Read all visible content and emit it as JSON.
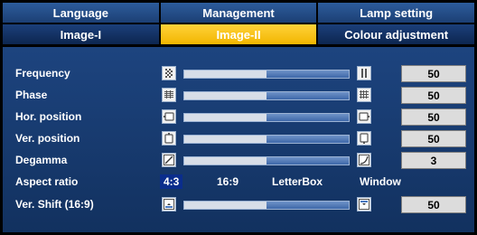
{
  "tabs_row1": [
    "Language",
    "Management",
    "Lamp setting"
  ],
  "tabs_row2": [
    "Image-I",
    "Image-II",
    "Colour adjustment"
  ],
  "active_tab": "Image-II",
  "rows": {
    "frequency": {
      "label": "Frequency",
      "value": "50",
      "level": 0.5
    },
    "phase": {
      "label": "Phase",
      "value": "50",
      "level": 0.5
    },
    "hor_position": {
      "label": "Hor. position",
      "value": "50",
      "level": 0.5
    },
    "ver_position": {
      "label": "Ver. position",
      "value": "50",
      "level": 0.5
    },
    "degamma": {
      "label": "Degamma",
      "value": "3",
      "level": 0.5
    },
    "aspect_ratio": {
      "label": "Aspect ratio",
      "options": [
        "4:3",
        "16:9",
        "LetterBox",
        "Window"
      ],
      "selected": "4:3"
    },
    "ver_shift": {
      "label": "Ver. Shift (16:9)",
      "value": "50",
      "level": 0.5
    }
  },
  "colors": {
    "active_tab": "#f7c314",
    "panel": "#1a3f78",
    "selected_option": "#0a2d8c"
  },
  "icons": [
    "frequency-icon",
    "phase-icon",
    "hor-position-icon",
    "ver-position-icon",
    "degamma-icon",
    "ver-shift-icon"
  ]
}
